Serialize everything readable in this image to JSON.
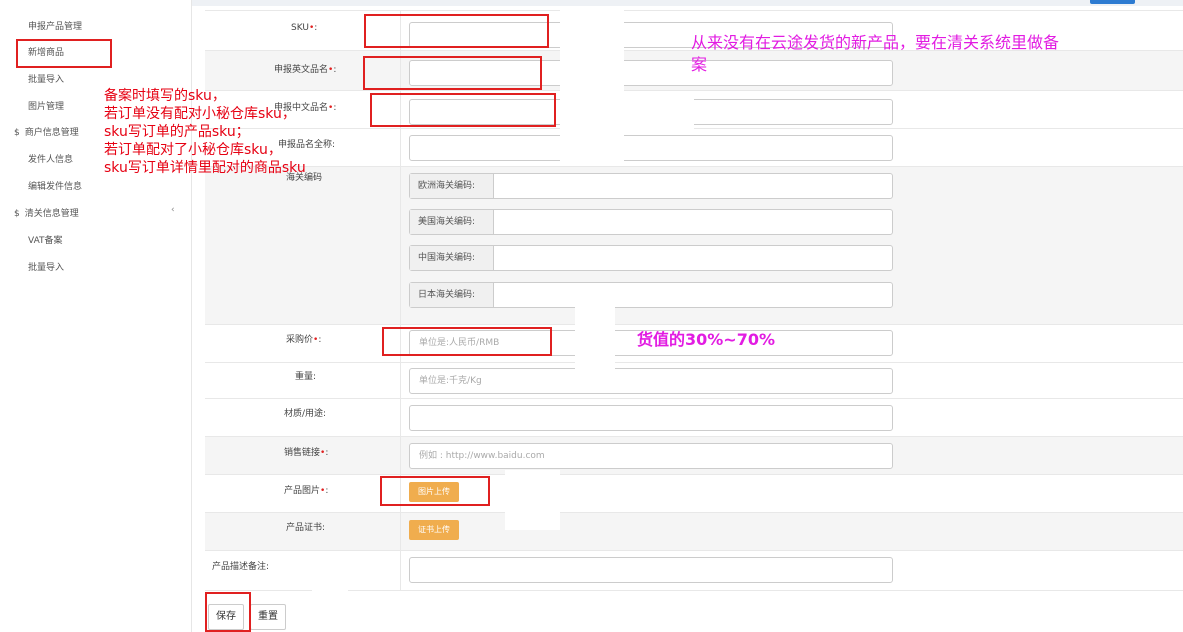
{
  "sidebar": {
    "items": [
      {
        "label": "申报产品管理"
      },
      {
        "label": "新增商品"
      },
      {
        "label": "批量导入"
      },
      {
        "label": "图片管理"
      }
    ],
    "groups": [
      {
        "label": "商户信息管理",
        "caret": "$"
      },
      {
        "label": "清关信息管理",
        "caret": "$",
        "chevron": "‹"
      }
    ],
    "merchant_items": [
      {
        "label": "发件人信息"
      },
      {
        "label": "编辑发件信息"
      }
    ],
    "customs_items": [
      {
        "label": "VAT备案"
      },
      {
        "label": "批量导入"
      }
    ]
  },
  "form": {
    "sku_label": "SKU",
    "en_name_label": "申报英文品名",
    "cn_name_label": "申报中文品名",
    "full_name_label": "申报品名全称",
    "customs_code_label": "海关编码",
    "hs_codes": [
      {
        "prefix": "欧洲海关编码:"
      },
      {
        "prefix": "美国海关编码:"
      },
      {
        "prefix": "中国海关编码:"
      },
      {
        "prefix": "日本海关编码:"
      }
    ],
    "purchase_price_label": "采购价",
    "purchase_price_placeholder": "单位是:人民币/RMB",
    "weight_label": "重量",
    "weight_placeholder": "单位是:千克/Kg",
    "material_label": "材质/用途",
    "sales_link_label": "销售链接",
    "sales_link_placeholder": "例如 : http://www.baidu.com",
    "product_image_label": "产品图片",
    "image_upload_button": "图片上传",
    "certificate_label": "产品证书",
    "certificate_upload_button": "证书上传",
    "description_label": "产品描述备注",
    "required_mark": "•",
    "colon": ":"
  },
  "actions": {
    "save": "保存",
    "reset": "重置"
  },
  "annotations": {
    "sku_note_lines": [
      "备案时填写的sku，",
      "若订单没有配对小秘仓库sku，",
      "sku写订单的产品sku；",
      "若订单配对了小秘仓库sku，",
      "sku写订单详情里配对的商品sku"
    ],
    "top_note_line1": "从来没有在云途发货的新产品，要在清关系统里做备",
    "top_note_line2": "案",
    "price_note": "货值的30%~70%"
  },
  "colors": {
    "annotation_red": "#e60012",
    "annotation_magenta": "#e21ce2",
    "highlight_box": "#e02020",
    "upload_button": "#f0ad4e"
  }
}
